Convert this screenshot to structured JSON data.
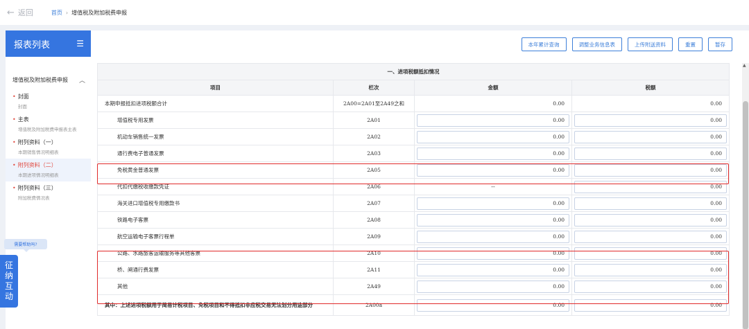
{
  "topbar": {
    "back_label": "返回",
    "breadcrumb_home": "首页",
    "breadcrumb_sep": "›",
    "breadcrumb_current": "增值税及附加税费申报"
  },
  "sidebar": {
    "title": "报表列表",
    "menu_icon": "list-icon",
    "group": {
      "label": "增值税及附加税费申报",
      "chevron": "^"
    },
    "items": [
      {
        "label": "封面",
        "sub": "封面",
        "active": false
      },
      {
        "label": "主表",
        "sub": "增值税及附加税费申报表主表",
        "active": false
      },
      {
        "label": "附列资料（一）",
        "sub": "本期销售情况明细表",
        "active": false
      },
      {
        "label": "附列资料（二）",
        "sub": "本期进项情况明细表",
        "active": true
      },
      {
        "label": "附列资料（三）",
        "sub": "附加税费情况表",
        "active": false
      }
    ],
    "help_tip": "需要帮助吗?",
    "float_button_chars": [
      "征",
      "纳",
      "互",
      "动"
    ]
  },
  "toolbar": {
    "buttons": [
      "本年累计查询",
      "调整业务信息表",
      "上传附送资料",
      "重置",
      "暂存"
    ]
  },
  "table": {
    "section_title": "一、进项税额抵扣情况",
    "headers": [
      "项目",
      "栏次",
      "金额",
      "税额"
    ],
    "rows": [
      {
        "item": "本期申报抵扣进项税额合计",
        "code": "2A00=2A01至2A49之和",
        "amount": "0.00",
        "tax": "0.00"
      },
      {
        "item": "增值税专用发票",
        "code": "2A01",
        "amount": "0.00",
        "tax": "0.00"
      },
      {
        "item": "机动车销售统一发票",
        "code": "2A02",
        "amount": "0.00",
        "tax": "0.00"
      },
      {
        "item": "通行费电子普通发票",
        "code": "2A03",
        "amount": "0.00",
        "tax": "0.00"
      },
      {
        "item": "免税黄金普通发票",
        "code": "2A05",
        "amount": "0.00",
        "tax": "0.00"
      },
      {
        "item": "代扣代缴税收缴款凭证",
        "code": "2A06",
        "amount": "--",
        "tax": "0.00"
      },
      {
        "item": "海关进口增值税专用缴款书",
        "code": "2A07",
        "amount": "0.00",
        "tax": "0.00"
      },
      {
        "item": "铁路电子客票",
        "code": "2A08",
        "amount": "0.00",
        "tax": "0.00"
      },
      {
        "item": "航空运输电子客票行程单",
        "code": "2A09",
        "amount": "0.00",
        "tax": "0.00"
      },
      {
        "item": "公路、水路旅客运输服务等其他客票",
        "code": "2A10",
        "amount": "0.00",
        "tax": "0.00"
      },
      {
        "item": "桥、闸通行费发票",
        "code": "2A11",
        "amount": "0.00",
        "tax": "0.00"
      },
      {
        "item": "其他",
        "code": "2A49",
        "amount": "0.00",
        "tax": "0.00"
      },
      {
        "item": "其中：上述进项税额用于简易计税项目、免税项目和不得抵扣非应税交易无法划分用途部分",
        "code": "2A00a",
        "amount": "0.00",
        "tax": "0.00"
      }
    ]
  },
  "colors": {
    "accent": "#3575e0",
    "highlight": "#e02a2a",
    "active_item": "#e0483e"
  }
}
